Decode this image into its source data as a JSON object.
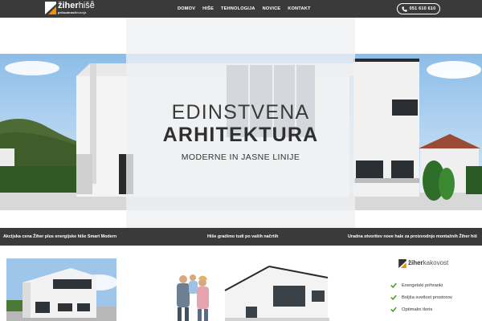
{
  "brand": {
    "name_bold": "žiher",
    "name_light": "hiše",
    "registered": "®",
    "tagline_bold": "pribudnost",
    "tagline_light": "bivanja"
  },
  "nav": {
    "items": [
      "DOMOV",
      "HIŠE",
      "TEHNOLOGIJA",
      "NOVICE",
      "KONTAKT"
    ]
  },
  "contact": {
    "phone": "051 610 610",
    "icon": "phone-icon"
  },
  "hero": {
    "title_line1": "EDINSTVENA",
    "title_line2": "ARHITEKTURA",
    "subtitle": "MODERNE IN JASNE LINIJE"
  },
  "announcements": [
    "Akcijska cena Žiher plus energijske hiše Smart Modern",
    "Hiše gradimo tudi po vaših načrtih",
    "Uradna otvoritev nove hale za proizvodnjo montažnih Žiher hiš"
  ],
  "features": {
    "logo_bold": "žiher",
    "logo_light": "kakovost",
    "items": [
      "Energetski prihranki",
      "Boljša svetlost prostorov",
      "Optimalni tloris"
    ],
    "check_color": "#4aa22f"
  },
  "colors": {
    "bar": "#3a3a3a",
    "accent_orange": "#f29100"
  }
}
